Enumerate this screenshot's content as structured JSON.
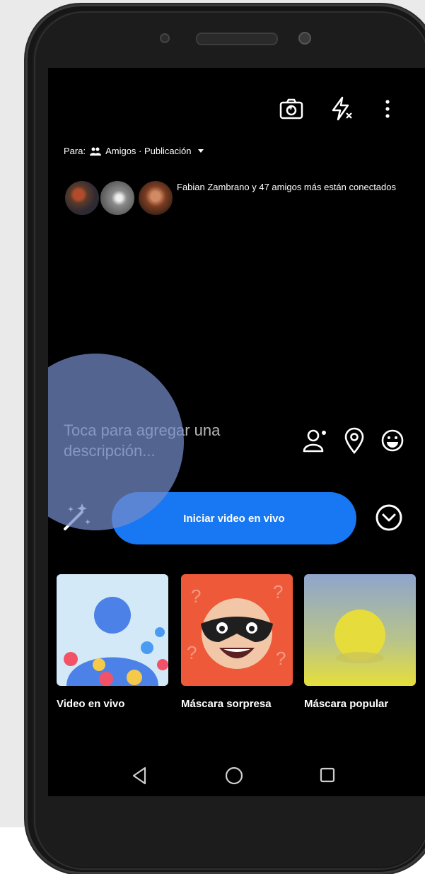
{
  "audience": {
    "prefix": "Para:",
    "value": "Amigos · Publicación"
  },
  "friends": {
    "text": "Fabian Zambrano y 47 amigos más están conectados"
  },
  "composer": {
    "placeholder": "Toca para agregar una descripción..."
  },
  "live_button": {
    "label": "Iniciar video en vivo"
  },
  "templates": [
    {
      "label": "Video en vivo"
    },
    {
      "label": "Máscara sorpresa"
    },
    {
      "label": "Máscara popular"
    }
  ],
  "icons": {
    "camera_switch": "camera-switch-icon",
    "flash": "flash-off-icon",
    "more": "more-vertical-icon",
    "tag_person": "tag-person-icon",
    "location": "location-pin-icon",
    "feeling": "smiley-icon",
    "effects": "magic-wand-icon",
    "expand": "chevron-down-circle-icon",
    "nav_back": "back-triangle-icon",
    "nav_home": "home-circle-icon",
    "nav_recents": "recents-square-icon"
  },
  "colors": {
    "accent": "#1877f2",
    "touch_indicator": "#758bc9",
    "screen_bg": "#000000"
  }
}
